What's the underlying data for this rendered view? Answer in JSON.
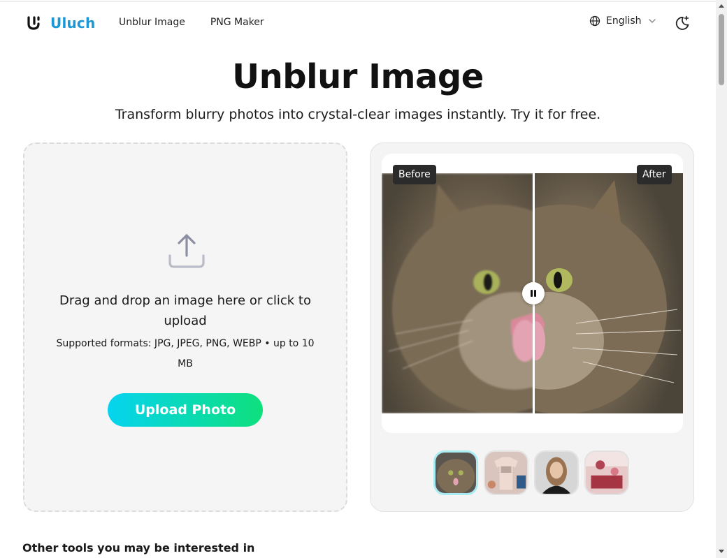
{
  "header": {
    "logo_text": "Uluch",
    "nav": [
      {
        "label": "Unblur Image"
      },
      {
        "label": "PNG Maker"
      }
    ],
    "language": {
      "label": "English",
      "icon": "globe-icon"
    },
    "theme_toggle_icon": "moon-sparkle-icon",
    "accent_color": "#1d97d6"
  },
  "hero": {
    "title": "Unblur Image",
    "subtitle": "Transform blurry photos into crystal-clear images instantly. Try it for free."
  },
  "upload": {
    "icon": "upload-icon",
    "main_text": "Drag and drop an image here or click to upload",
    "formats_text": "Supported formats: JPG, JPEG, PNG, WEBP • up to 10 MB",
    "button_label": "Upload Photo",
    "button_gradient": [
      "#06d3ef",
      "#0ee07d"
    ]
  },
  "compare": {
    "before_label": "Before",
    "after_label": "After",
    "slider_position": 0.5,
    "handle_icon": "pause-icon",
    "thumbnails": [
      {
        "name": "cat",
        "active": true
      },
      {
        "name": "t-shirt",
        "active": false
      },
      {
        "name": "portrait",
        "active": false
      },
      {
        "name": "room",
        "active": false
      }
    ]
  },
  "footer_section": {
    "other_tools_title": "Other tools you may be interested in"
  }
}
